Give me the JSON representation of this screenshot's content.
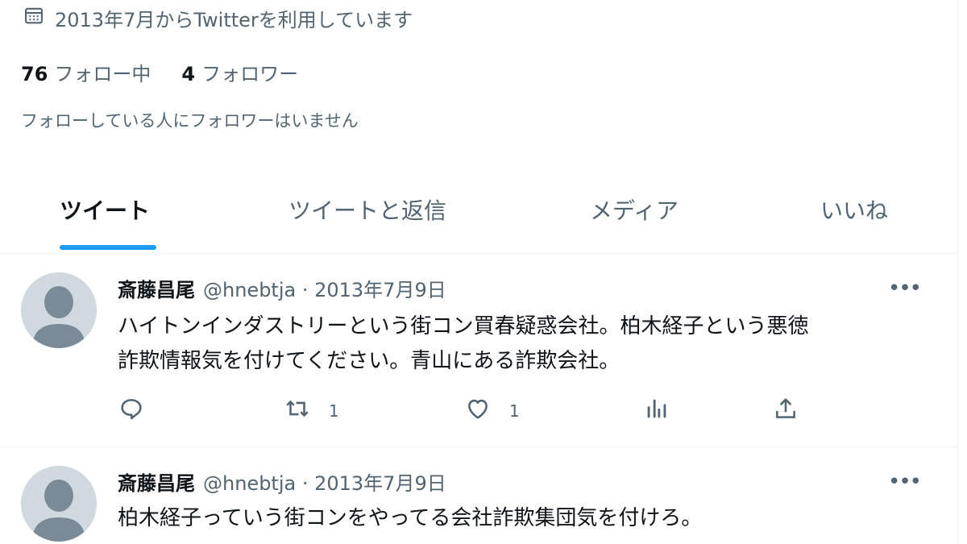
{
  "profile": {
    "joined": "2013年7月からTwitterを利用しています",
    "following_count": "76",
    "following_label": "フォロー中",
    "followers_count": "4",
    "followers_label": "フォロワー",
    "known_followers": "フォローしている人にフォロワーはいません"
  },
  "tabs": [
    {
      "label": "ツイート",
      "active": true
    },
    {
      "label": "ツイートと返信"
    },
    {
      "label": "メディア"
    },
    {
      "label": "いいね"
    }
  ],
  "tweets": [
    {
      "name": "斎藤昌尾",
      "handle_date": "@hnebtja · 2013年7月9日",
      "lines": [
        "ハイトンインダストリーという街コン買春疑惑会社。柏木経子という悪徳",
        "詐欺情報気を付けてください。青山にある詐欺会社。"
      ],
      "retweets": "1",
      "likes": "1"
    },
    {
      "name": "斎藤昌尾",
      "handle_date": "@hnebtja · 2013年7月9日",
      "lines": [
        "柏木経子っていう街コンをやってる会社詐欺集団気を付けろ。"
      ]
    }
  ],
  "icons": {
    "calendar": "calendar-icon",
    "more": "more-icon",
    "reply": "reply-icon",
    "retweet": "retweet-icon",
    "like": "heart-icon",
    "views": "views-icon",
    "share": "share-icon"
  },
  "colors": {
    "accent": "#1d9bf0",
    "text": "#0f1419",
    "secondary": "#536471",
    "avatar_bg": "#cfd9de"
  }
}
